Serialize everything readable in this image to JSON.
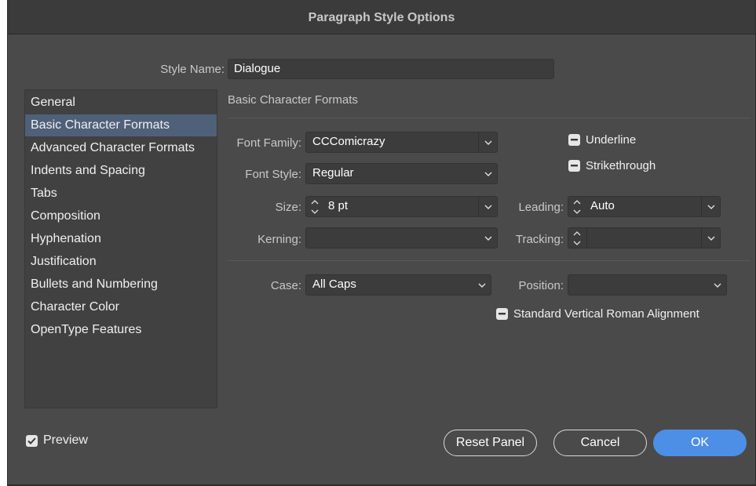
{
  "window": {
    "title": "Paragraph Style Options"
  },
  "style_name": {
    "label": "Style Name:",
    "value": "Dialogue"
  },
  "sidebar": {
    "items": [
      {
        "label": "General",
        "selected": false
      },
      {
        "label": "Basic Character Formats",
        "selected": true
      },
      {
        "label": "Advanced Character Formats",
        "selected": false
      },
      {
        "label": "Indents and Spacing",
        "selected": false
      },
      {
        "label": "Tabs",
        "selected": false
      },
      {
        "label": "Composition",
        "selected": false
      },
      {
        "label": "Hyphenation",
        "selected": false
      },
      {
        "label": "Justification",
        "selected": false
      },
      {
        "label": "Bullets and Numbering",
        "selected": false
      },
      {
        "label": "Character Color",
        "selected": false
      },
      {
        "label": "OpenType Features",
        "selected": false
      }
    ]
  },
  "panel": {
    "heading": "Basic Character Formats",
    "font_family": {
      "label": "Font Family:",
      "value": "CCComicrazy"
    },
    "font_style": {
      "label": "Font Style:",
      "value": "Regular"
    },
    "size": {
      "label": "Size:",
      "value": "8 pt"
    },
    "leading": {
      "label": "Leading:",
      "value": "Auto"
    },
    "kerning": {
      "label": "Kerning:",
      "value": ""
    },
    "tracking": {
      "label": "Tracking:",
      "value": ""
    },
    "case": {
      "label": "Case:",
      "value": "All Caps"
    },
    "position": {
      "label": "Position:",
      "value": ""
    },
    "underline": {
      "label": "Underline",
      "state": "mixed"
    },
    "strikethrough": {
      "label": "Strikethrough",
      "state": "mixed"
    },
    "vertical_roman": {
      "label": "Standard Vertical Roman Alignment",
      "state": "mixed"
    }
  },
  "footer": {
    "preview": {
      "label": "Preview",
      "checked": true
    },
    "reset_label": "Reset Panel",
    "cancel_label": "Cancel",
    "ok_label": "OK"
  },
  "colors": {
    "selection": "#4f6079",
    "primary_button": "#4d8fe6",
    "background": "#4a4a4a"
  }
}
